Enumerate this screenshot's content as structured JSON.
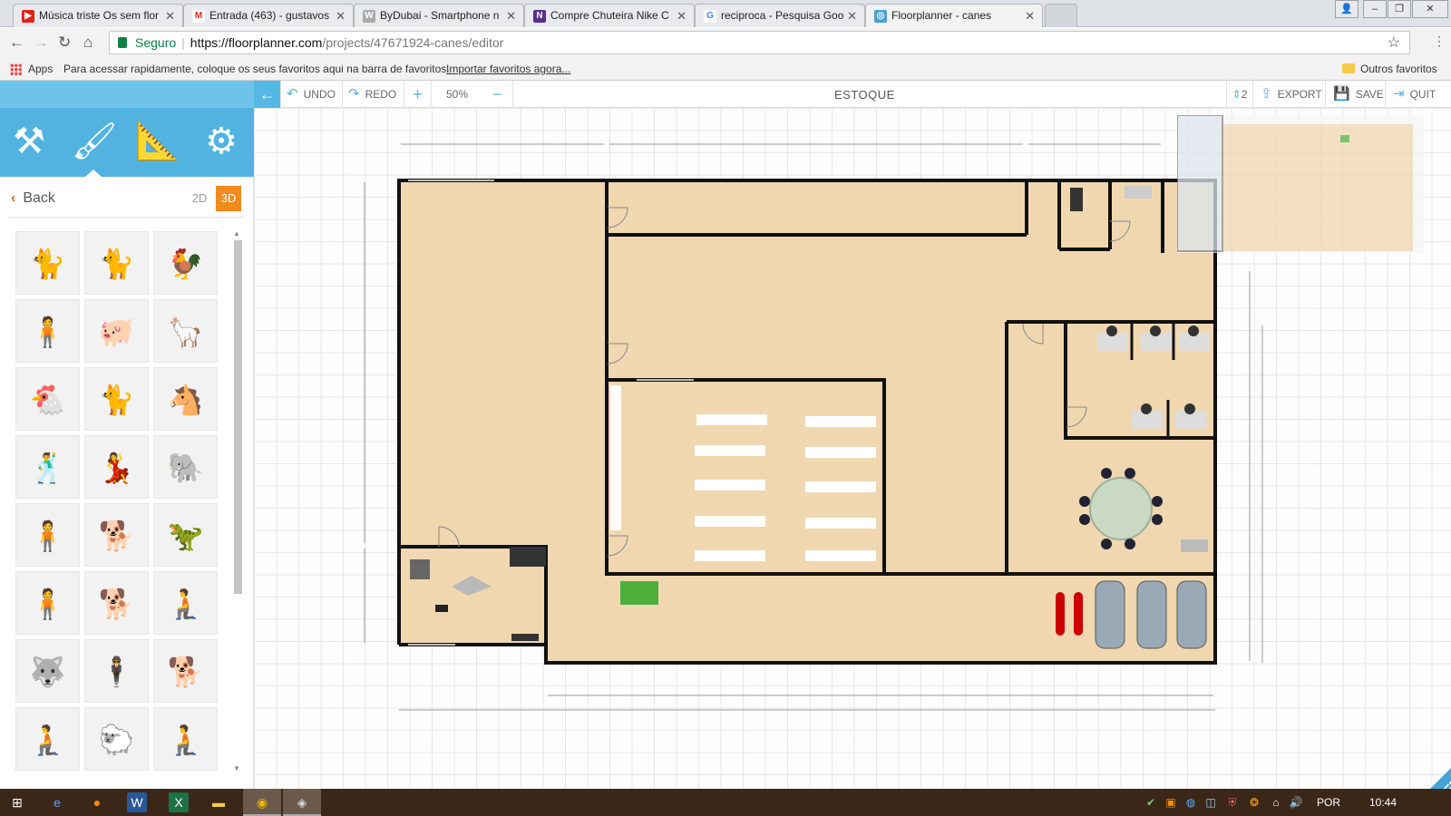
{
  "browser": {
    "tabs": [
      {
        "title": "Música triste Os sem flor",
        "icon": "youtube-icon",
        "color": "#e62117"
      },
      {
        "title": "Entrada (463) - gustavos",
        "icon": "gmail-icon",
        "color": "#d93025"
      },
      {
        "title": "ByDubai - Smartphone n",
        "icon": "bydubai-icon",
        "color": "#8a8a8a"
      },
      {
        "title": "Compre Chuteira Nike C",
        "icon": "netshoes-icon",
        "color": "#5b2d8f"
      },
      {
        "title": "reciproca - Pesquisa Goo",
        "icon": "google-icon",
        "color": "#4285f4"
      },
      {
        "title": "Floorplanner - canes",
        "icon": "floorplanner-icon",
        "color": "#45a3d8"
      }
    ],
    "secure_label": "Seguro",
    "url_host": "https://floorplanner.com",
    "url_path": "/projects/47671924-canes/editor",
    "bookmarks": {
      "apps_label": "Apps",
      "hint": "Para acessar rapidamente, coloque os seus favoritos aqui na barra de favoritos.",
      "import_link": "Importar favoritos agora...",
      "other": "Outros favoritos"
    }
  },
  "app": {
    "toolbar": {
      "undo": "UNDO",
      "redo": "REDO",
      "zoom": "50%",
      "title": "ESTOQUE",
      "floor_count": "2",
      "export": "EXPORT",
      "save": "SAVE",
      "quit": "QUIT"
    },
    "sidebar": {
      "back": "Back",
      "mode_2d": "2D",
      "mode_3d": "3D",
      "items": [
        "🐈",
        "🐈",
        "🐓",
        "🧍",
        "🐖",
        "🦙",
        "🐔",
        "🐈",
        "🐴",
        "🕺",
        "💃",
        "🐘",
        "🧍",
        "🐕",
        "🦖",
        "🧍",
        "🐕",
        "🧎",
        "🐺",
        "🕴",
        "🐕",
        "🧎",
        "🐑",
        "🧎"
      ]
    },
    "feedback": "FEEDBACK"
  },
  "taskbar": {
    "language": "POR",
    "time": "10:44"
  }
}
